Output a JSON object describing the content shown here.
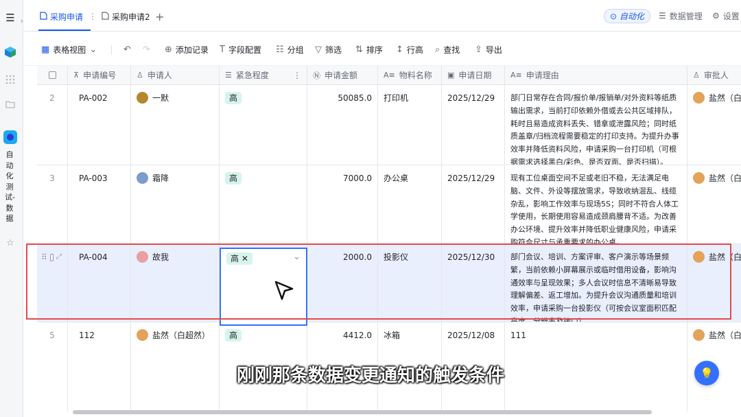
{
  "tabs": [
    {
      "label": "采购申请"
    },
    {
      "label": "采购申请2"
    }
  ],
  "header_right": {
    "automation": "自动化",
    "data_management": "数据管理",
    "settings": "设置"
  },
  "sidebar": {
    "vertical_title": "自动化测试-数据"
  },
  "toolbar": {
    "view": "表格视图",
    "add_record": "添加记录",
    "field_config": "字段配置",
    "group": "分组",
    "filter": "筛选",
    "sort": "排序",
    "row_height": "行高",
    "find": "查找",
    "export": "导出"
  },
  "columns": [
    "申请编号",
    "申请人",
    "紧急程度",
    "申请金额",
    "物料名称",
    "申请日期",
    "申请理由",
    "审批人"
  ],
  "rows": [
    {
      "index": "2",
      "id": "PA-002",
      "applicant": "一默",
      "urgency": "高",
      "amount": "50085.0",
      "material": "打印机",
      "date": "2025/12/29",
      "reason": "部门日常存在合同/报价单/报销单/对外资料等纸质输出需求，当前打印依赖外借或去公共区域排队，耗时且易造成资料丢失、错拿或泄露风险；同时纸质盖章/归档流程需要稳定的打印支持。为提升办事效率并降低资料风险，申请采购一台打印机（可根据需求选择黑白/彩色、是否双面、是否扫描）。",
      "approver": "盐然（白超然）"
    },
    {
      "index": "3",
      "id": "PA-003",
      "applicant": "霜降",
      "urgency": "高",
      "amount": "7000.0",
      "material": "办公桌",
      "date": "2025/12/29",
      "reason": "现有工位桌面空间不足或老旧不稳，无法满足电脑、文件、外设等摆放需求，导致收纳混乱、线缆杂乱，影响工作效率与现场5S；同时不符合人体工学使用，长期使用容易造成颈肩腰背不适。为改善办公环境、提升效率并降低职业健康风险，申请采购符合尺寸与承重要求的办公桌。",
      "approver": "盐然（白超然）"
    },
    {
      "index": "",
      "id": "PA-004",
      "applicant": "故我",
      "urgency": "高",
      "amount": "2000.0",
      "material": "投影仪",
      "date": "2025/12/30",
      "reason": "部门会议、培训、方案评审、客户演示等场景频繁，当前依赖小屏幕展示或临时借用设备，影响沟通效率与呈现效果；多人会议时信息不清晰易导致理解偏差、返工增加。为提升会议沟通质量和培训效率，申请采购一台投影仪（可按会议室面积匹配亮度、分辨率及接口）。",
      "approver": "盐然（白超然）"
    },
    {
      "index": "5",
      "id": "112",
      "applicant": "盐然（白超然）",
      "urgency": "高",
      "amount": "4412.0",
      "material": "冰箱",
      "date": "2025/12/08",
      "reason": "111",
      "approver": "盐然（白超然）"
    }
  ],
  "caption": "刚刚那条数据变更通知的触发条件",
  "colors": {
    "accent": "#1456f0",
    "tag_bg": "#d7f4ec",
    "highlight": "#e5484d"
  }
}
